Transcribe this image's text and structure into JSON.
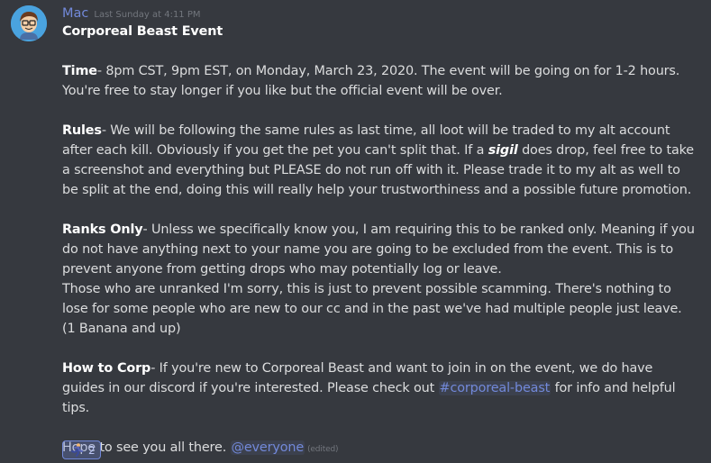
{
  "message": {
    "username": "Mac",
    "timestamp": "Last Sunday at 4:11 PM",
    "title": "Corporeal Beast Event",
    "time": {
      "label": "Time",
      "text": "- 8pm CST, 9pm EST, on Monday, March 23, 2020. The event will be going on for 1-2 hours. You're free to stay longer if you like but the official event will be over."
    },
    "rules": {
      "label": "Rules",
      "text_before": "- We will be following the same rules as last time, all loot will be traded to my alt account after each kill. Obviously if you get the pet you can't split that. If a ",
      "emphasis": "sigil",
      "text_after": " does drop, feel free to take a screenshot and everything but PLEASE do not run off with it. Please trade it to my alt as well to be split at the end, doing this will really help your trustworthiness and a possible future promotion."
    },
    "ranks": {
      "label": "Ranks Only",
      "text": "- Unless we specifically know you, I am requiring this to be ranked only. Meaning if you do not have anything next to your name you are going to be excluded from the event. This is to prevent anyone from getting drops who may potentially log or leave.",
      "text2": "Those who are unranked I'm sorry, this is just to prevent possible scamming. There's nothing to lose for some people who are new to our cc and in the past we've had multiple people just leave. (1 Banana and up)"
    },
    "corp": {
      "label": "How to Corp",
      "text_before": "- If you're new to Corporeal Beast and want to join in on the event, we do have guides in our discord if you're interested. Please check out ",
      "channel": "#corporeal-beast",
      "text_after": " for info and helpful tips."
    },
    "closing": {
      "text": "Hope to see you all there. ",
      "mention": "@everyone",
      "edited": "(edited)"
    },
    "reaction": {
      "icon": "running-person-emoji",
      "count": "2"
    }
  },
  "colors": {
    "background": "#36393f",
    "username": "#7289da",
    "text": "#dcddde",
    "muted": "#72767d"
  }
}
